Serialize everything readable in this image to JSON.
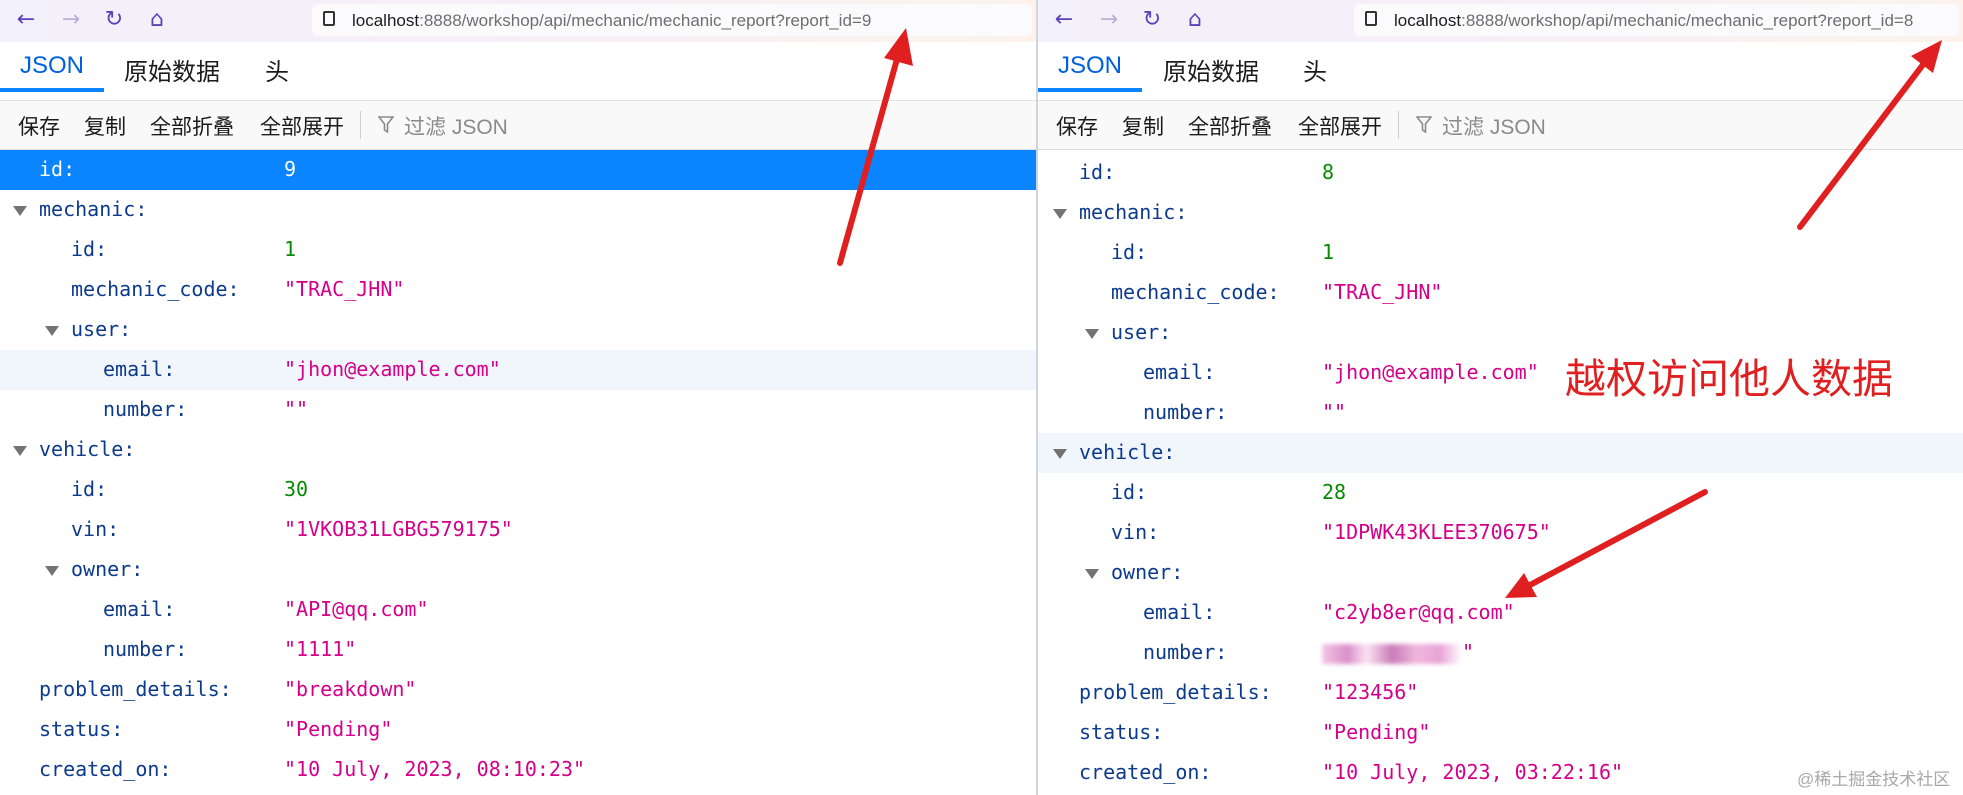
{
  "left": {
    "url_host": "localhost",
    "url_path": ":8888/workshop/api/mechanic/mechanic_report?report_id=9",
    "tabs": [
      "JSON",
      "原始数据",
      "头"
    ],
    "toolbar": [
      "保存",
      "复制",
      "全部折叠",
      "全部展开"
    ],
    "filter_placeholder": "过滤 JSON",
    "rows": [
      {
        "key": "id:",
        "value": "9",
        "type": "num",
        "depth": 0,
        "state": "selected"
      },
      {
        "key": "mechanic:",
        "depth": 0,
        "expandable": true
      },
      {
        "key": "id:",
        "value": "1",
        "type": "num",
        "depth": 1
      },
      {
        "key": "mechanic_code:",
        "value": "\"TRAC_JHN\"",
        "type": "str",
        "depth": 1
      },
      {
        "key": "user:",
        "depth": 1,
        "expandable": true
      },
      {
        "key": "email:",
        "value": "\"jhon@example.com\"",
        "type": "str",
        "depth": 2,
        "state": "hover"
      },
      {
        "key": "number:",
        "value": "\"\"",
        "type": "str",
        "depth": 2
      },
      {
        "key": "vehicle:",
        "depth": 0,
        "expandable": true
      },
      {
        "key": "id:",
        "value": "30",
        "type": "num",
        "depth": 1
      },
      {
        "key": "vin:",
        "value": "\"1VKOB31LGBG579175\"",
        "type": "str",
        "depth": 1
      },
      {
        "key": "owner:",
        "depth": 1,
        "expandable": true
      },
      {
        "key": "email:",
        "value": "\"API@qq.com\"",
        "type": "str",
        "depth": 2
      },
      {
        "key": "number:",
        "value": "\"1111\"",
        "type": "str",
        "depth": 2
      },
      {
        "key": "problem_details:",
        "value": "\"breakdown\"",
        "type": "str",
        "depth": 0
      },
      {
        "key": "status:",
        "value": "\"Pending\"",
        "type": "str",
        "depth": 0
      },
      {
        "key": "created_on:",
        "value": "\"10 July, 2023, 08:10:23\"",
        "type": "str",
        "depth": 0
      }
    ]
  },
  "right": {
    "url_host": "localhost",
    "url_path": ":8888/workshop/api/mechanic/mechanic_report?report_id=8",
    "tabs": [
      "JSON",
      "原始数据",
      "头"
    ],
    "toolbar": [
      "保存",
      "复制",
      "全部折叠",
      "全部展开"
    ],
    "filter_placeholder": "过滤 JSON",
    "rows": [
      {
        "key": "id:",
        "value": "8",
        "type": "num",
        "depth": 0
      },
      {
        "key": "mechanic:",
        "depth": 0,
        "expandable": true
      },
      {
        "key": "id:",
        "value": "1",
        "type": "num",
        "depth": 1
      },
      {
        "key": "mechanic_code:",
        "value": "\"TRAC_JHN\"",
        "type": "str",
        "depth": 1
      },
      {
        "key": "user:",
        "depth": 1,
        "expandable": true
      },
      {
        "key": "email:",
        "value": "\"jhon@example.com\"",
        "type": "str",
        "depth": 2
      },
      {
        "key": "number:",
        "value": "\"\"",
        "type": "str",
        "depth": 2
      },
      {
        "key": "vehicle:",
        "depth": 0,
        "expandable": true,
        "state": "hover"
      },
      {
        "key": "id:",
        "value": "28",
        "type": "num",
        "depth": 1
      },
      {
        "key": "vin:",
        "value": "\"1DPWK43KLEE370675\"",
        "type": "str",
        "depth": 1
      },
      {
        "key": "owner:",
        "depth": 1,
        "expandable": true
      },
      {
        "key": "email:",
        "value": "\"c2yb8er@qq.com\"",
        "type": "str",
        "depth": 2
      },
      {
        "key": "number:",
        "value": "\"",
        "type": "str",
        "depth": 2,
        "redacted": true
      },
      {
        "key": "problem_details:",
        "value": "\"123456\"",
        "type": "str",
        "depth": 0
      },
      {
        "key": "status:",
        "value": "\"Pending\"",
        "type": "str",
        "depth": 0
      },
      {
        "key": "created_on:",
        "value": "\"10 July, 2023, 03:22:16\"",
        "type": "str",
        "depth": 0
      }
    ]
  },
  "annotation": "越权访问他人数据",
  "watermark": "@稀土掘金技术社区",
  "colors": {
    "selected_row": "#0a84ff",
    "active_tab": "#0060df",
    "key": "#0c3a8c",
    "string_value": "#d4008a",
    "number_value": "#058b00",
    "annotation_red": "#e02020"
  },
  "icons": [
    "back-arrow-icon",
    "forward-arrow-icon",
    "reload-icon",
    "home-icon",
    "page-icon",
    "filter-icon",
    "expand-triangle-icon",
    "red-arrow-annotation"
  ]
}
